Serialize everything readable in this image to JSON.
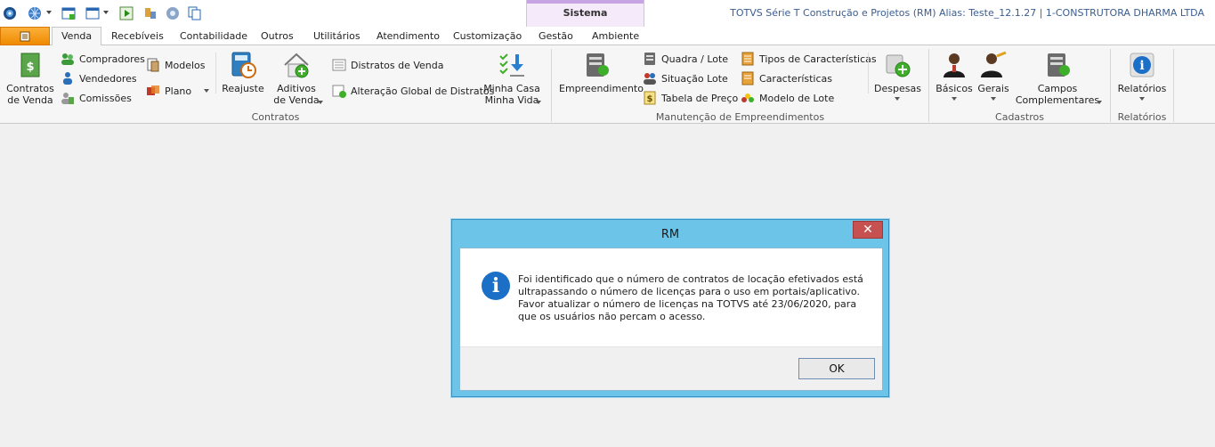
{
  "app": {
    "title": "TOTVS Série T Construção e Projetos (RM) Alias: Teste_12.1.27 | 1-CONSTRUTORA DHARMA LTDA",
    "context_group": "Sistema"
  },
  "tabs": [
    "Venda",
    "Recebíveis",
    "Contabilidade",
    "Outros",
    "Utilitários",
    "Atendimento",
    "Customização",
    "Gestão",
    "Ambiente"
  ],
  "ribbon": {
    "contratos": {
      "label": "Contratos",
      "contratos_venda": "Contratos\nde Venda",
      "compradores": "Compradores",
      "vendedores": "Vendedores",
      "comissoes": "Comissões",
      "modelos": "Modelos",
      "plano": "Plano",
      "reajuste": "Reajuste",
      "aditivos": "Aditivos\nde Venda",
      "distratos": "Distratos de Venda",
      "alteracao": "Alteração Global de Distratos",
      "minha_casa": "Minha Casa\nMinha Vida"
    },
    "manutencao": {
      "label": "Manutenção de Empreendimentos",
      "empreendimento": "Empreendimento",
      "quadra_lote": "Quadra / Lote",
      "situacao_lote": "Situação Lote",
      "tabela_preco": "Tabela de Preço",
      "tipos_caracteristicas": "Tipos de Características",
      "caracteristicas": "Características",
      "modelo_lote": "Modelo de Lote",
      "despesas": "Despesas"
    },
    "cadastros": {
      "label": "Cadastros",
      "basicos": "Básicos",
      "gerais": "Gerais",
      "campos": "Campos\nComplementares"
    },
    "relatorios": {
      "label": "Relatórios",
      "relatorios": "Relatórios"
    }
  },
  "dialog": {
    "title": "RM",
    "close": "✕",
    "message": "Foi identificado que o número de contratos de locação efetivados está\nultrapassando o número de licenças para o uso em portais/aplicativo.\nFavor atualizar o número de licenças na TOTVS até 23/06/2020, para\nque os usuários não percam o acesso.",
    "ok": "OK"
  },
  "colors": {
    "dialog_frame": "#6cc5e9",
    "close_button": "#c75050",
    "app_menu": "#f08a00",
    "context_tab": "#c7a4e4"
  },
  "icons": [
    "app-orb-icon",
    "globe-icon",
    "window-icon",
    "play-icon",
    "info-icon",
    "close-icon"
  ]
}
